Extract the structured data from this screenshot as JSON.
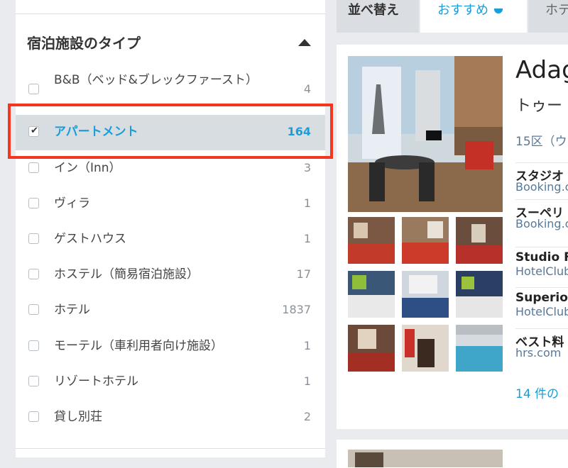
{
  "sidebar": {
    "section_title": "宿泊施設のタイプ",
    "items": [
      {
        "label": "B&B（ベッド&ブレックファースト）",
        "count": "4",
        "checked": false
      },
      {
        "label": "アパートメント",
        "count": "164",
        "checked": true
      },
      {
        "label": "イン（Inn）",
        "count": "3",
        "checked": false
      },
      {
        "label": "ヴィラ",
        "count": "1",
        "checked": false
      },
      {
        "label": "ゲストハウス",
        "count": "1",
        "checked": false
      },
      {
        "label": "ホステル（簡易宿泊施設）",
        "count": "17",
        "checked": false
      },
      {
        "label": "ホテル",
        "count": "1837",
        "checked": false
      },
      {
        "label": "モーテル（車利用者向け施設）",
        "count": "1",
        "checked": false
      },
      {
        "label": "リゾートホテル",
        "count": "1",
        "checked": false
      },
      {
        "label": "貸し別荘",
        "count": "2",
        "checked": false
      }
    ]
  },
  "sortbar": {
    "label": "並べ替え",
    "active_tab": "おすすめ",
    "next_tab": "ホテ"
  },
  "hotel": {
    "name": "Adag",
    "subtitle": "トゥー",
    "location": "15区（ウ",
    "deals": [
      {
        "room": "スタジオ",
        "site": "Booking.c"
      },
      {
        "room": "スーペリ",
        "site": "Booking.c"
      },
      {
        "room": "Studio Fo",
        "site": "HotelClub"
      },
      {
        "room": "Superior",
        "site": "HotelClub"
      },
      {
        "room": "ベスト料",
        "site": "hrs.com"
      }
    ],
    "more_link": "14 件の"
  },
  "colors": {
    "accent": "#1a9ed9",
    "highlight": "#f2361f",
    "selected_bg": "#d8dde2"
  }
}
